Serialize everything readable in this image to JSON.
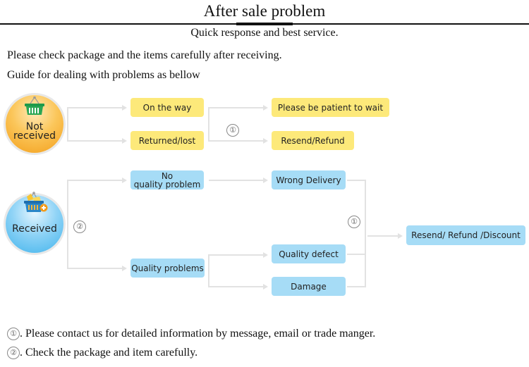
{
  "header": {
    "title": "After sale problem",
    "subtitle": "Quick response and best service."
  },
  "intro": {
    "line1": "Please check package and the items carefully after receiving.",
    "line2": "Guide for dealing with problems as bellow"
  },
  "colors": {
    "yellow_box": "#fde97a",
    "blue_box": "#a6dcf6",
    "connector": "#e2e2e2"
  },
  "not_received": {
    "badge_line1": "Not",
    "badge_line2": "received",
    "badge_icon": "basket-icon",
    "states": [
      "On the way",
      "Returned/lost"
    ],
    "marker": "①",
    "outcomes": [
      "Please be patient to wait",
      "Resend/Refund"
    ]
  },
  "received": {
    "badge_label": "Received",
    "badge_icon": "basket-with-plus-icon",
    "marker": "②",
    "states": {
      "no_problem_line1": "No",
      "no_problem_line2": "quality problem",
      "quality_problems": "Quality problems"
    },
    "issues": [
      "Wrong Delivery",
      "Quality defect",
      "Damage"
    ],
    "marker_issues": "①",
    "outcome": "Resend/ Refund /Discount"
  },
  "notes": [
    {
      "marker": "①",
      "text": ". Please contact us for detailed information by message, email or trade manger."
    },
    {
      "marker": "②",
      "text": ". Check the package and item carefully."
    }
  ]
}
